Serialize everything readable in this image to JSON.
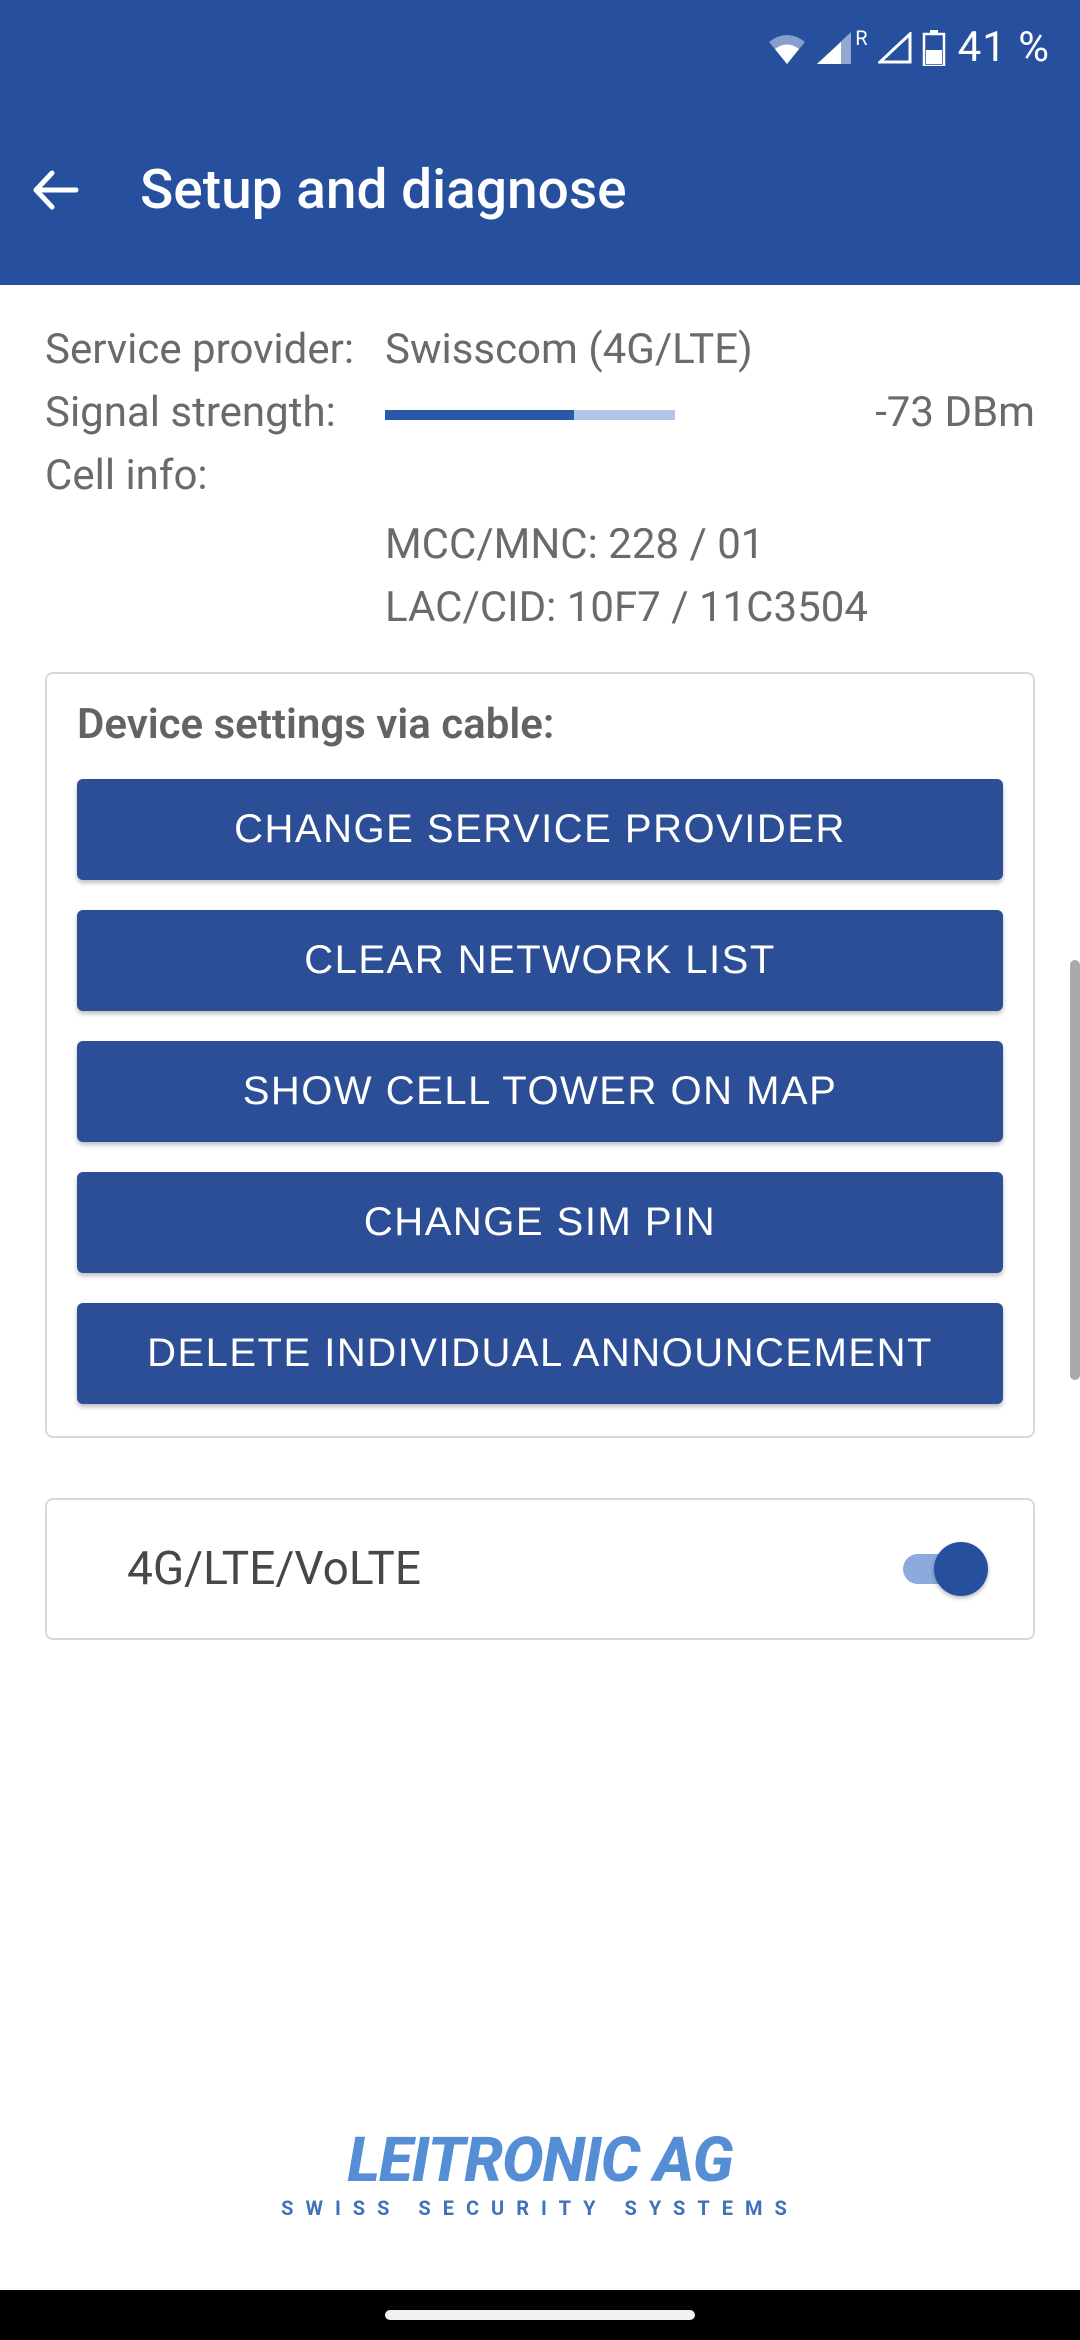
{
  "status": {
    "battery": "41 %"
  },
  "header": {
    "title": "Setup and diagnose"
  },
  "info": {
    "provider_label": "Service provider:",
    "provider_value": "Swisscom (4G/LTE)",
    "signal_label": "Signal strength:",
    "signal_value": "-73 DBm",
    "signal_percent": 65,
    "cell_label": "Cell info:",
    "cell_line1": "MCC/MNC: 228 / 01",
    "cell_line2": "LAC/CID: 10F7 / 11C3504"
  },
  "settings": {
    "title": "Device settings via cable:",
    "buttons": {
      "change_provider": "CHANGE SERVICE PROVIDER",
      "clear_network": "CLEAR NETWORK LIST",
      "show_tower": "SHOW CELL TOWER ON MAP",
      "change_pin": "CHANGE SIM PIN",
      "delete_announcement": "DELETE INDIVIDUAL ANNOUNCEMENT"
    }
  },
  "toggle": {
    "label": "4G/LTE/VoLTE",
    "on": true
  },
  "footer": {
    "brand": "LEITRONIC AG",
    "tagline": "SWISS SECURITY SYSTEMS"
  }
}
